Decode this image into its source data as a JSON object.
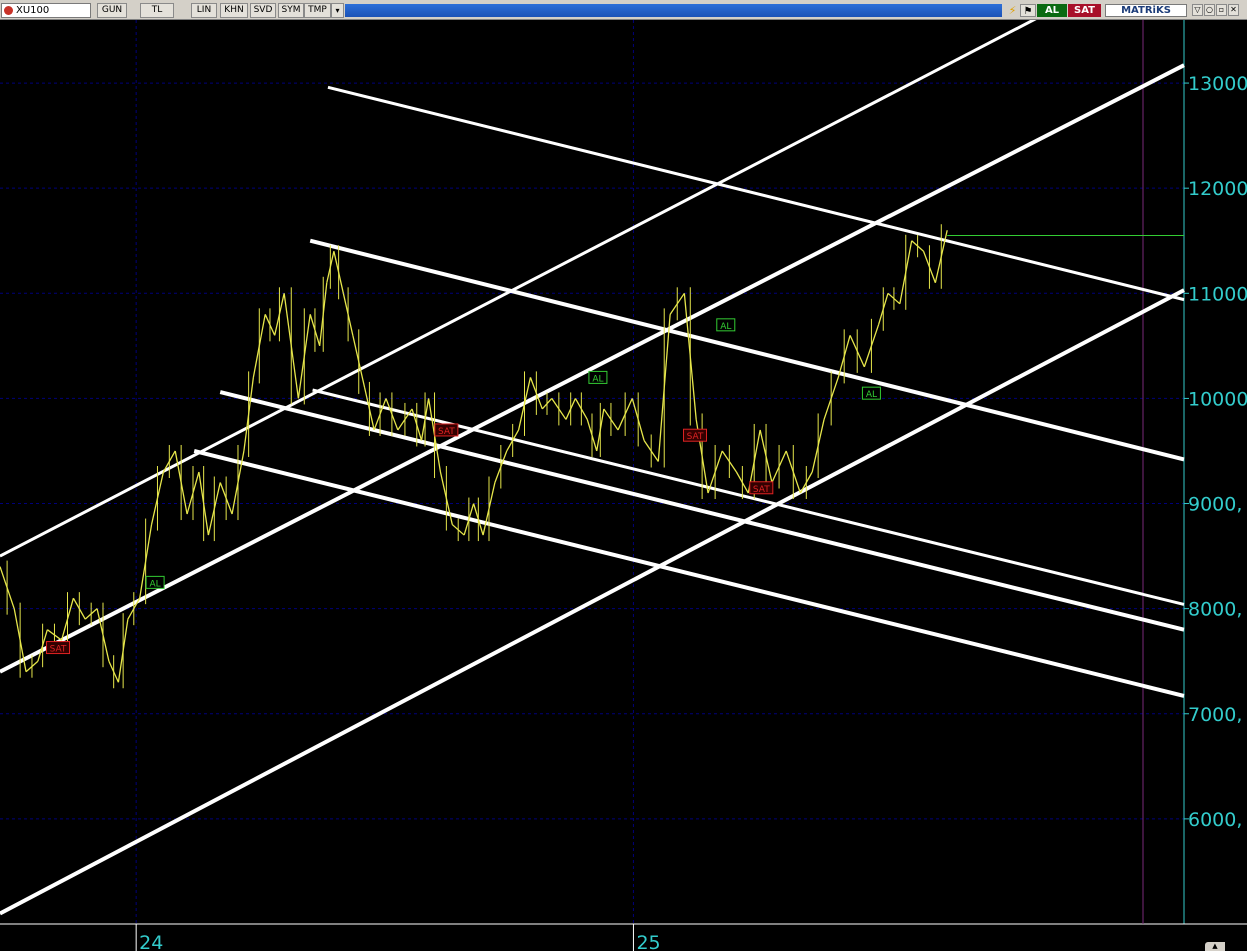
{
  "toolbar": {
    "symbol": "XU100",
    "buttons": [
      "GUN",
      "TL",
      "LIN",
      "KHN",
      "SVD",
      "SYM",
      "TMP"
    ],
    "dropdown_glyph": "▾",
    "buy_label": "AL",
    "sell_label": "SAT",
    "brand": "MATRiKS",
    "window_buttons": [
      "▽",
      "○",
      "▫",
      "✕"
    ],
    "icon": "bolt-icon"
  },
  "chart_data": {
    "type": "line",
    "title": "",
    "xlabel": "",
    "ylabel": "",
    "ylim": [
      5000,
      13600
    ],
    "yticks": [
      {
        "value": 6000,
        "label": "6000,"
      },
      {
        "value": 7000,
        "label": "7000,"
      },
      {
        "value": 8000,
        "label": "8000,"
      },
      {
        "value": 9000,
        "label": "9000,"
      },
      {
        "value": 10000,
        "label": "10000"
      },
      {
        "value": 11000,
        "label": "11000"
      },
      {
        "value": 12000,
        "label": "12000"
      },
      {
        "value": 13000,
        "label": "13000"
      }
    ],
    "xticks": [
      {
        "value": 0.115,
        "label": "24"
      },
      {
        "value": 0.535,
        "label": "25"
      }
    ],
    "xlim": [
      0,
      1
    ],
    "grid": true,
    "colors": {
      "background": "#000000",
      "price": "#e6e64b",
      "trendlines": "#ffffff",
      "axis_labels": "#33cccc",
      "grid": "#00007a",
      "last_price_line": "#33cc33",
      "buy_signal": "#33cc33",
      "sell_signal": "#dd2222",
      "separator": "#7a2a7a"
    },
    "series": [
      {
        "x": [
          0.0,
          0.012,
          0.022,
          0.032,
          0.04,
          0.052,
          0.062,
          0.072,
          0.082,
          0.092,
          0.1,
          0.108,
          0.118,
          0.128,
          0.138,
          0.148,
          0.158,
          0.168,
          0.176,
          0.186,
          0.196,
          0.206,
          0.214,
          0.224,
          0.232,
          0.24,
          0.252,
          0.262,
          0.27,
          0.276,
          0.282,
          0.29,
          0.298,
          0.308,
          0.316,
          0.326,
          0.336,
          0.348,
          0.356,
          0.362,
          0.372,
          0.382,
          0.392,
          0.4,
          0.408,
          0.418,
          0.428,
          0.438,
          0.448,
          0.458,
          0.466,
          0.478,
          0.486,
          0.496,
          0.504,
          0.51,
          0.522,
          0.534,
          0.544,
          0.556,
          0.566,
          0.578,
          0.588,
          0.598,
          0.61,
          0.622,
          0.632,
          0.642,
          0.652,
          0.664,
          0.676,
          0.686,
          0.696,
          0.708,
          0.718,
          0.73,
          0.742,
          0.75,
          0.76,
          0.77,
          0.78,
          0.79,
          0.8
        ],
        "values": [
          8400,
          8000,
          7400,
          7500,
          7800,
          7700,
          8100,
          7900,
          8000,
          7500,
          7300,
          7900,
          8100,
          8800,
          9300,
          9500,
          8900,
          9300,
          8700,
          9200,
          8900,
          9500,
          10200,
          10800,
          10600,
          11000,
          10000,
          10800,
          10500,
          11100,
          11400,
          11000,
          10600,
          10100,
          9700,
          10000,
          9700,
          9900,
          9600,
          10000,
          9300,
          8800,
          8700,
          9000,
          8700,
          9200,
          9500,
          9700,
          10200,
          9900,
          10000,
          9800,
          10000,
          9800,
          9500,
          9900,
          9700,
          10000,
          9600,
          9400,
          10800,
          11000,
          9800,
          9100,
          9500,
          9300,
          9100,
          9700,
          9200,
          9500,
          9100,
          9300,
          9800,
          10200,
          10600,
          10300,
          10700,
          11000,
          10900,
          11500,
          11400,
          11100,
          11600
        ]
      }
    ],
    "annotations": [
      {
        "text": "SAT",
        "x": 0.049,
        "y": 7630
      },
      {
        "text": "AL",
        "x": 0.131,
        "y": 8250
      },
      {
        "text": "SAT",
        "x": 0.377,
        "y": 9700
      },
      {
        "text": "AL",
        "x": 0.505,
        "y": 10200
      },
      {
        "text": "SAT",
        "x": 0.587,
        "y": 9650
      },
      {
        "text": "AL",
        "x": 0.613,
        "y": 10700
      },
      {
        "text": "SAT",
        "x": 0.643,
        "y": 9150
      },
      {
        "text": "AL",
        "x": 0.736,
        "y": 10050
      }
    ],
    "last_price": 11550,
    "trendlines": [
      {
        "x1": 0.0,
        "y1": 8500,
        "x2": 0.907,
        "y2": 13800
      },
      {
        "x1": 0.0,
        "y1": 7400,
        "x2": 1.0,
        "y2": 13170
      },
      {
        "x1": 0.0,
        "y1": 5100,
        "x2": 1.0,
        "y2": 11030
      },
      {
        "x1": 0.277,
        "y1": 12960,
        "x2": 1.0,
        "y2": 10940
      },
      {
        "x1": 0.262,
        "y1": 11500,
        "x2": 1.0,
        "y2": 9420
      },
      {
        "x1": 0.186,
        "y1": 10060,
        "x2": 1.0,
        "y2": 7800
      },
      {
        "x1": 0.264,
        "y1": 10080,
        "x2": 1.0,
        "y2": 8040
      },
      {
        "x1": 0.164,
        "y1": 9500,
        "x2": 1.0,
        "y2": 7170
      }
    ]
  }
}
